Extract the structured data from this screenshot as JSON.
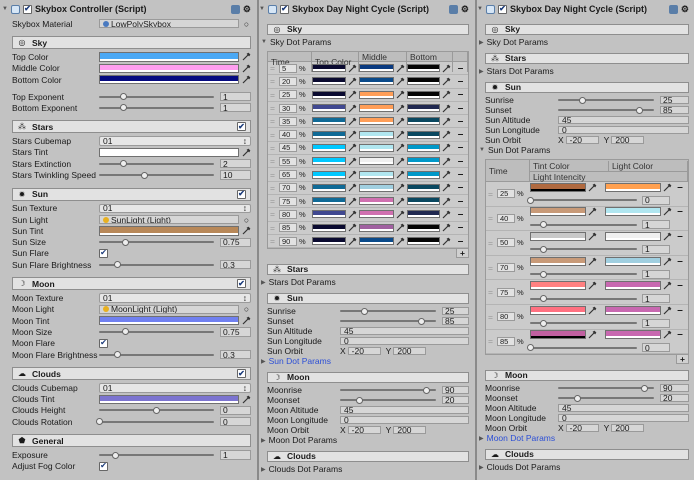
{
  "panels": [
    {
      "title": "Skybox Controller (Script)",
      "enabled": true,
      "rows": [
        {
          "type": "object",
          "label": "Skybox Material",
          "value": "LowPolySkybox",
          "icon": "material-icon"
        },
        {
          "type": "section",
          "title": "Sky",
          "icon": "sky-icon"
        },
        {
          "type": "color",
          "label": "Top Color",
          "color": "#4aa8f4"
        },
        {
          "type": "color",
          "label": "Middle Color",
          "color": "#ff9ef0"
        },
        {
          "type": "color",
          "label": "Bottom Color",
          "color": "#050a80"
        },
        {
          "type": "space"
        },
        {
          "type": "slider",
          "label": "Top Exponent",
          "value": "1",
          "fraction": 0.21
        },
        {
          "type": "slider",
          "label": "Bottom Exponent",
          "value": "1",
          "fraction": 0.21
        },
        {
          "type": "section",
          "title": "Stars",
          "icon": "stars-icon",
          "toggle": true
        },
        {
          "type": "dropdown",
          "label": "Stars Cubemap",
          "value": "01"
        },
        {
          "type": "color",
          "label": "Stars Tint",
          "color": "#ffffff"
        },
        {
          "type": "slider",
          "label": "Stars Extinction",
          "value": "2",
          "fraction": 0.21
        },
        {
          "type": "slider",
          "label": "Stars Twinkling Speed",
          "value": "10",
          "fraction": 0.4
        },
        {
          "type": "section",
          "title": "Sun",
          "icon": "sun-icon",
          "toggle": true
        },
        {
          "type": "dropdown",
          "label": "Sun Texture",
          "value": "01"
        },
        {
          "type": "object",
          "label": "Sun Light",
          "value": "SunLight (Light)",
          "icon": "light-icon"
        },
        {
          "type": "color",
          "label": "Sun Tint",
          "color": "#b88858"
        },
        {
          "type": "slider",
          "label": "Sun Size",
          "value": "0.75",
          "fraction": 0.23
        },
        {
          "type": "check",
          "label": "Sun Flare",
          "checked": true
        },
        {
          "type": "slider",
          "label": "Sun Flare Brightness",
          "value": "0.3",
          "fraction": 0.16
        },
        {
          "type": "section",
          "title": "Moon",
          "icon": "moon-icon",
          "toggle": true
        },
        {
          "type": "dropdown",
          "label": "Moon Texture",
          "value": "01"
        },
        {
          "type": "object",
          "label": "Moon Light",
          "value": "MoonLight (Light)",
          "icon": "light-icon"
        },
        {
          "type": "color",
          "label": "Moon Tint",
          "color": "#7080f0"
        },
        {
          "type": "slider",
          "label": "Moon Size",
          "value": "0.75",
          "fraction": 0.23
        },
        {
          "type": "check",
          "label": "Moon Flare",
          "checked": true
        },
        {
          "type": "slider",
          "label": "Moon Flare Brightness",
          "value": "0.3",
          "fraction": 0.16
        },
        {
          "type": "section",
          "title": "Clouds",
          "icon": "cloud-icon",
          "toggle": true
        },
        {
          "type": "dropdown",
          "label": "Clouds Cubemap",
          "value": "01"
        },
        {
          "type": "color",
          "label": "Clouds Tint",
          "color": "#7c74d0"
        },
        {
          "type": "slider",
          "label": "Clouds Height",
          "value": "0",
          "fraction": 0.5
        },
        {
          "type": "slider",
          "label": "Clouds Rotation",
          "value": "0",
          "fraction": 0.0
        },
        {
          "type": "section",
          "title": "General",
          "icon": "general-icon"
        },
        {
          "type": "slider",
          "label": "Exposure",
          "value": "1",
          "fraction": 0.14
        },
        {
          "type": "check",
          "label": "Adjust Fog Color",
          "checked": true
        }
      ]
    },
    {
      "title": "Skybox Day Night Cycle (Script)",
      "enabled": true,
      "rows": [
        {
          "type": "section",
          "title": "Sky",
          "icon": "sky-icon"
        },
        {
          "type": "foldout",
          "label": "Sky Dot Params",
          "expanded": true
        },
        {
          "type": "skytable",
          "unit": "%",
          "headers": [
            "Time",
            "Top Color",
            "Middle Color",
            "Bottom Color"
          ],
          "rows": [
            {
              "time": "5",
              "top": "#0a0a30",
              "middle": "#0a3a80",
              "bottom": "#050505"
            },
            {
              "time": "20",
              "top": "#0a0a30",
              "middle": "#0a4a8a",
              "bottom": "#050505"
            },
            {
              "time": "25",
              "top": "#0a0a30",
              "middle": "#ff9e58",
              "bottom": "#050505"
            },
            {
              "time": "30",
              "top": "#404890",
              "middle": "#ff9e58",
              "bottom": "#202850"
            },
            {
              "time": "35",
              "top": "#106a96",
              "middle": "#ff9e58",
              "bottom": "#0a4860"
            },
            {
              "time": "40",
              "top": "#106a96",
              "middle": "#b0e6f0",
              "bottom": "#0a4860"
            },
            {
              "time": "45",
              "top": "#00c8ff",
              "middle": "#b0e6f0",
              "bottom": "#0098c8"
            },
            {
              "time": "55",
              "top": "#00c8ff",
              "middle": "#f0f0f0",
              "bottom": "#0098c8"
            },
            {
              "time": "65",
              "top": "#00c8ff",
              "middle": "#b0e6f0",
              "bottom": "#0098c8"
            },
            {
              "time": "70",
              "top": "#106a96",
              "middle": "#a0cfe0",
              "bottom": "#0a4860"
            },
            {
              "time": "75",
              "top": "#106a96",
              "middle": "#d070b0",
              "bottom": "#0a4860"
            },
            {
              "time": "80",
              "top": "#404890",
              "middle": "#d070b0",
              "bottom": "#202850"
            },
            {
              "time": "85",
              "top": "#0a0a30",
              "middle": "#a060a0",
              "bottom": "#050505"
            },
            {
              "time": "90",
              "top": "#0a0a30",
              "middle": "#0a4a8a",
              "bottom": "#050505"
            }
          ]
        },
        {
          "type": "section",
          "title": "Stars",
          "icon": "stars-icon"
        },
        {
          "type": "foldout",
          "label": "Stars Dot Params",
          "expanded": false
        },
        {
          "type": "section",
          "title": "Sun",
          "icon": "sun-icon"
        },
        {
          "type": "slider",
          "label": "Sunrise",
          "value": "25",
          "fraction": 0.25
        },
        {
          "type": "slider",
          "label": "Sunset",
          "value": "85",
          "fraction": 0.85
        },
        {
          "type": "field",
          "label": "Sun Altitude",
          "value": "45"
        },
        {
          "type": "field",
          "label": "Sun Longitude",
          "value": "0"
        },
        {
          "type": "vector",
          "label": "Sun Orbit",
          "xl": "X",
          "x": "-20",
          "yl": "Y",
          "y": "200"
        },
        {
          "type": "foldout",
          "label": "Sun Dot Params",
          "expanded": false,
          "active": true
        },
        {
          "type": "section",
          "title": "Moon",
          "icon": "moon-icon"
        },
        {
          "type": "slider",
          "label": "Moonrise",
          "value": "90",
          "fraction": 0.9
        },
        {
          "type": "slider",
          "label": "Moonset",
          "value": "20",
          "fraction": 0.2
        },
        {
          "type": "field",
          "label": "Moon Altitude",
          "value": "45"
        },
        {
          "type": "field",
          "label": "Moon Longitude",
          "value": "0"
        },
        {
          "type": "vector",
          "label": "Moon Orbit",
          "xl": "X",
          "x": "-20",
          "yl": "Y",
          "y": "200"
        },
        {
          "type": "foldout",
          "label": "Moon Dot Params",
          "expanded": false
        },
        {
          "type": "section",
          "title": "Clouds",
          "icon": "cloud-icon"
        },
        {
          "type": "foldout",
          "label": "Clouds Dot Params",
          "expanded": false
        }
      ]
    },
    {
      "title": "Skybox Day Night Cycle (Script)",
      "enabled": true,
      "rows": [
        {
          "type": "section",
          "title": "Sky",
          "icon": "sky-icon"
        },
        {
          "type": "foldout",
          "label": "Sky Dot Params",
          "expanded": false
        },
        {
          "type": "section",
          "title": "Stars",
          "icon": "stars-icon"
        },
        {
          "type": "foldout",
          "label": "Stars Dot Params",
          "expanded": false
        },
        {
          "type": "section",
          "title": "Sun",
          "icon": "sun-icon"
        },
        {
          "type": "slider",
          "label": "Sunrise",
          "value": "25",
          "fraction": 0.25
        },
        {
          "type": "slider",
          "label": "Sunset",
          "value": "85",
          "fraction": 0.85
        },
        {
          "type": "field",
          "label": "Sun Altitude",
          "value": "45"
        },
        {
          "type": "field",
          "label": "Sun Longitude",
          "value": "0"
        },
        {
          "type": "vector",
          "label": "Sun Orbit",
          "xl": "X",
          "x": "-20",
          "yl": "Y",
          "y": "200"
        },
        {
          "type": "foldout",
          "label": "Sun Dot Params",
          "expanded": true
        },
        {
          "type": "suntable",
          "unit": "%",
          "headers": [
            "Time",
            "Tint Color",
            "Light Color",
            "Light Intencity"
          ],
          "rows": [
            {
              "time": "25",
              "tint": "#b06a40",
              "tint_alpha0": true,
              "light": "#ffa050",
              "intensity": "0",
              "fraction": 0.0
            },
            {
              "time": "40",
              "tint": "#c89a78",
              "light": "#b0e6f0",
              "intensity": "1",
              "fraction": 0.13
            },
            {
              "time": "50",
              "tint": "#c8c8c8",
              "light": "#f0f0f0",
              "intensity": "1",
              "fraction": 0.13
            },
            {
              "time": "70",
              "tint": "#c89a78",
              "light": "#a0cfe0",
              "intensity": "1",
              "fraction": 0.13
            },
            {
              "time": "75",
              "tint": "#ff8080",
              "light": "#c868b0",
              "intensity": "1",
              "fraction": 0.13
            },
            {
              "time": "80",
              "tint": "#ff7080",
              "light": "#c868b0",
              "intensity": "1",
              "fraction": 0.13
            },
            {
              "time": "85",
              "tint": "#c060a0",
              "tint_alpha0": true,
              "light": "#c868b0",
              "intensity": "0",
              "fraction": 0.0
            }
          ]
        },
        {
          "type": "section",
          "title": "Moon",
          "icon": "moon-icon"
        },
        {
          "type": "slider",
          "label": "Moonrise",
          "value": "90",
          "fraction": 0.9
        },
        {
          "type": "slider",
          "label": "Moonset",
          "value": "20",
          "fraction": 0.2
        },
        {
          "type": "field",
          "label": "Moon Altitude",
          "value": "45"
        },
        {
          "type": "field",
          "label": "Moon Longitude",
          "value": "0"
        },
        {
          "type": "vector",
          "label": "Moon Orbit",
          "xl": "X",
          "x": "-20",
          "yl": "Y",
          "y": "200"
        },
        {
          "type": "foldout",
          "label": "Moon Dot Params",
          "expanded": false,
          "active": true
        },
        {
          "type": "section",
          "title": "Clouds",
          "icon": "cloud-icon"
        },
        {
          "type": "foldout",
          "label": "Clouds Dot Params",
          "expanded": false
        }
      ]
    }
  ]
}
